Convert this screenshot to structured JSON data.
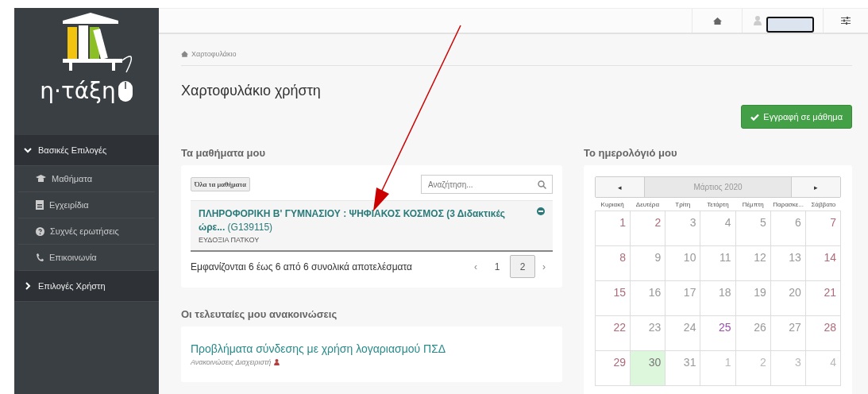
{
  "logo": {
    "text": "η·τάξη"
  },
  "sidebar": {
    "groups": [
      {
        "title": "Βασικές Επιλογές",
        "expanded": true,
        "items": [
          {
            "label": "Μαθήματα",
            "kind": "courses"
          },
          {
            "label": "Εγχειρίδια",
            "kind": "manuals"
          },
          {
            "label": "Συχνές ερωτήσεις",
            "kind": "faq"
          },
          {
            "label": "Επικοινωνία",
            "kind": "contact"
          }
        ]
      },
      {
        "title": "Επιλογές Χρήστη",
        "expanded": false
      }
    ]
  },
  "breadcrumb": "Χαρτοφυλάκιο",
  "page_title": "Χαρτοφυλάκιο χρήστη",
  "register_button": "Εγγραφή σε μάθημα",
  "courses": {
    "heading": "Τα μαθήματα μου",
    "all_button": "Όλα τα μαθήματα",
    "search": {
      "placeholder": "Αναζήτηση..."
    },
    "items": [
      {
        "title": "**ΠΛΗΡΟΦΟΡΙΚΗ Β' ΓΥΜΝΑΣΙΟΥ : ΨΗΦΙΑΚΟΣ ΚΟΣΜΟΣ (3 Διδακτικές ώρε...** (G139115)",
        "teacher": "ΕΥΔΟΞΙΑ ΠΑΤΚΟΥ"
      }
    ],
    "summary": "Εμφανίζονται 6 έως 6 από 6 συνολικά αποτελέσματα",
    "pager": {
      "prev": "‹",
      "next": "›",
      "pages": [
        {
          "label": "1",
          "selected": false
        },
        {
          "label": "2",
          "selected": true
        }
      ]
    }
  },
  "announcements": {
    "heading": "Οι τελευταίες μου ανακοινώσεις",
    "items": [
      {
        "title": "Προβλήματα σύνδεσης με χρήση λογαριασμού ΠΣΔ",
        "source": "Ανακοινώσεις Διαχειριστή"
      }
    ]
  },
  "calendar": {
    "heading": "Το ημερολόγιό μου",
    "month": "Μάρτιος 2020",
    "prev": "◂",
    "next": "▸",
    "weekdays": [
      "Κυριακή",
      "Δευτέρα",
      "Τρίτη",
      "Τετάρτη",
      "Πέμπτη",
      "Παρασκε...",
      "Σάββατο"
    ],
    "days": [
      {
        "label": "1",
        "kind": "weekend"
      },
      {
        "label": "2",
        "kind": "holiday"
      },
      {
        "label": "3",
        "kind": "normal"
      },
      {
        "label": "4",
        "kind": "normal"
      },
      {
        "label": "5",
        "kind": "normal"
      },
      {
        "label": "6",
        "kind": "normal"
      },
      {
        "label": "7",
        "kind": "weekend"
      },
      {
        "label": "8",
        "kind": "weekend"
      },
      {
        "label": "9",
        "kind": "normal"
      },
      {
        "label": "10",
        "kind": "normal"
      },
      {
        "label": "11",
        "kind": "normal"
      },
      {
        "label": "12",
        "kind": "normal"
      },
      {
        "label": "13",
        "kind": "normal"
      },
      {
        "label": "14",
        "kind": "weekend"
      },
      {
        "label": "15",
        "kind": "weekend"
      },
      {
        "label": "16",
        "kind": "normal"
      },
      {
        "label": "17",
        "kind": "normal"
      },
      {
        "label": "18",
        "kind": "normal"
      },
      {
        "label": "19",
        "kind": "normal"
      },
      {
        "label": "20",
        "kind": "normal"
      },
      {
        "label": "21",
        "kind": "weekend"
      },
      {
        "label": "22",
        "kind": "weekend"
      },
      {
        "label": "23",
        "kind": "normal"
      },
      {
        "label": "24",
        "kind": "normal"
      },
      {
        "label": "25",
        "kind": "event"
      },
      {
        "label": "26",
        "kind": "normal"
      },
      {
        "label": "27",
        "kind": "normal"
      },
      {
        "label": "28",
        "kind": "weekend"
      },
      {
        "label": "29",
        "kind": "weekend"
      },
      {
        "label": "30",
        "kind": "today"
      },
      {
        "label": "31",
        "kind": "normal"
      },
      {
        "label": "1",
        "kind": "other"
      },
      {
        "label": "2",
        "kind": "other"
      },
      {
        "label": "3",
        "kind": "other"
      },
      {
        "label": "4",
        "kind": "other"
      }
    ]
  }
}
